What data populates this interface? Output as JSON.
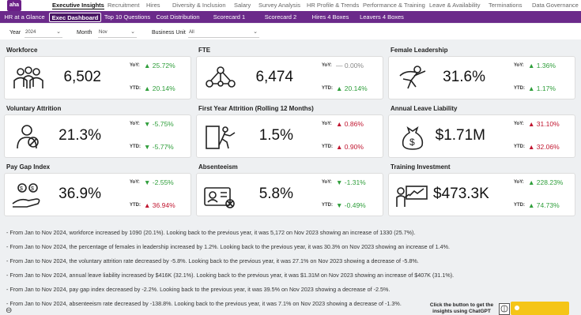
{
  "brand": {
    "logo_text": "aha",
    "purple": "#6b2a8a",
    "up_color": "#2e9e3a",
    "down_color": "#c0152f"
  },
  "topnav": [
    "Executive Insights",
    "Recruitment",
    "Hires",
    "Diversity & Inclusion",
    "Salary",
    "Survey Analysis",
    "HR Profile & Trends",
    "Performance & Training",
    "Leave & Availability",
    "Terminations",
    "Data Governance"
  ],
  "subnav": [
    "HR at a Glance",
    "Exec Dashboard",
    "Top 10 Questions",
    "Cost Distribution",
    "Scorecard 1",
    "Scorecard 2",
    "Hires 4 Boxes",
    "Leavers 4 Boxes"
  ],
  "filters": {
    "year_label": "Year",
    "year_value": "2024",
    "month_label": "Month",
    "month_value": "Nov",
    "bu_label": "Business Unit",
    "bu_value": "All"
  },
  "cards": [
    {
      "title": "Workforce",
      "icon": "people-group-icon",
      "value": "6,502",
      "yoy_label": "YoY:",
      "yoy": "25.72%",
      "yoy_dir": "up",
      "ytd_label": "YTD:",
      "ytd": "20.14%",
      "ytd_dir": "up"
    },
    {
      "title": "FTE",
      "icon": "network-people-icon",
      "value": "6,474",
      "yoy_label": "YoY:",
      "yoy": "0.00%",
      "yoy_dir": "flat",
      "ytd_label": "YTD:",
      "ytd": "20.14%",
      "ytd_dir": "up"
    },
    {
      "title": "Female Leadership",
      "icon": "superwoman-icon",
      "value": "31.6%",
      "yoy_label": "YoY:",
      "yoy": "1.36%",
      "yoy_dir": "up",
      "ytd_label": "YTD:",
      "ytd": "1.17%",
      "ytd_dir": "up"
    },
    {
      "title": "Voluntary Attrition",
      "icon": "person-exit-icon",
      "value": "21.3%",
      "yoy_label": "YoY:",
      "yoy": "-5.75%",
      "yoy_dir": "down-good",
      "ytd_label": "YTD:",
      "ytd": "-5.77%",
      "ytd_dir": "down-good"
    },
    {
      "title": "First Year Attrition (Rolling 12 Months)",
      "icon": "door-exit-icon",
      "value": "1.5%",
      "yoy_label": "YoY:",
      "yoy": "0.86%",
      "yoy_dir": "up-bad",
      "ytd_label": "YTD:",
      "ytd": "0.90%",
      "ytd_dir": "up-bad"
    },
    {
      "title": "Annual Leave Liability",
      "icon": "money-bag-icon",
      "value": "$1.71M",
      "yoy_label": "YoY:",
      "yoy": "31.10%",
      "yoy_dir": "up-bad",
      "ytd_label": "YTD:",
      "ytd": "32.06%",
      "ytd_dir": "up-bad"
    },
    {
      "title": "Pay Gap Index",
      "icon": "hand-coins-icon",
      "value": "36.9%",
      "yoy_label": "YoY:",
      "yoy": "-2.55%",
      "yoy_dir": "down-good",
      "ytd_label": "YTD:",
      "ytd": "36.94%",
      "ytd_dir": "up-bad"
    },
    {
      "title": "Absenteeism",
      "icon": "id-card-icon",
      "value": "5.8%",
      "yoy_label": "YoY:",
      "yoy": "-1.31%",
      "yoy_dir": "down-good",
      "ytd_label": "YTD:",
      "ytd": "-0.49%",
      "ytd_dir": "down-good"
    },
    {
      "title": "Training Investment",
      "icon": "presenter-icon",
      "value": "$473.3K",
      "yoy_label": "YoY:",
      "yoy": "228.23%",
      "yoy_dir": "up",
      "ytd_label": "YTD:",
      "ytd": "74.73%",
      "ytd_dir": "up"
    }
  ],
  "notes": [
    "- From Jan to Nov 2024, workforce increased by 1090 (20.1%). Looking back to the previous year, it was 5,172 on Nov 2023 showing an increase of 1330 (25.7%).",
    "- From Jan to Nov 2024, the percentage of females in leadership increased by 1.2%. Looking back to the previous year, it was 30.3% on Nov 2023 showing an increase of 1.4%.",
    "- From Jan to Nov 2024, the voluntary attrition rate decreased by -5.8%. Looking back to the previous year, it was 27.1% on Nov 2023 showing a decrease of -5.8%.",
    "- From Jan to Nov 2024, annual leave liability increased by $416K (32.1%). Looking back to the previous year, it was $1.31M on Nov 2023 showing an increase of $407K (31.1%).",
    "- From Jan to Nov 2024, pay gap index decreased by -2.2%. Looking back to the previous year, it was 39.5% on Nov 2023 showing a decrease of -2.5%.",
    "- From Jan to Nov 2024, absenteeism rate decreased by -138.8%. Looking back to the previous year, it was 7.1% on Nov 2023 showing a decrease of -1.3%."
  ],
  "cta": {
    "text": "Click the button to get the insights using ChatGPT"
  }
}
